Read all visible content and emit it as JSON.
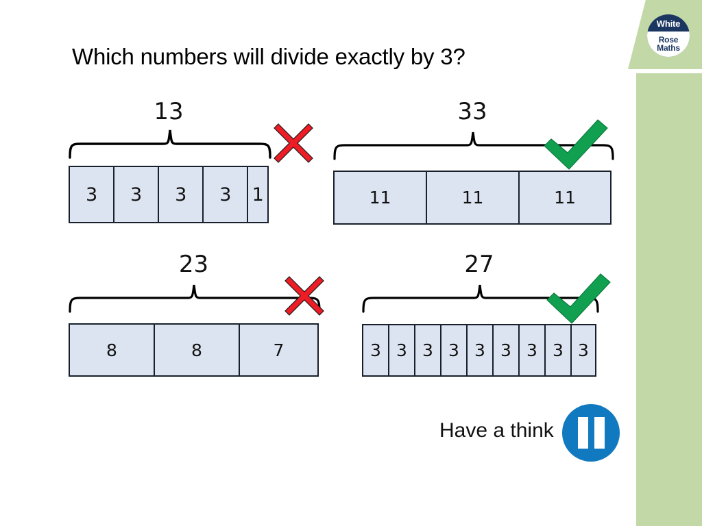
{
  "slide": {
    "title": "Which numbers will divide exactly by 3?",
    "brand": {
      "logo_line1": "White",
      "logo_line2": "Rose",
      "logo_line3": "Maths",
      "panel_color": "#c2d8a6",
      "logo_color": "#1b3661"
    },
    "prompt": {
      "label": "Have a think",
      "icon": "pause-icon",
      "icon_color": "#1179bf"
    },
    "colors": {
      "cell_fill": "#dde4f1",
      "cell_border": "#17202b",
      "cross": "#ee1c25",
      "tick": "#10a04f"
    }
  },
  "models": [
    {
      "id": "model-13",
      "total": "13",
      "parts": [
        "3",
        "3",
        "3",
        "3",
        "1"
      ],
      "part_widths": [
        66,
        66,
        66,
        66,
        32
      ],
      "verdict": "cross",
      "verdict_name": "cross-icon"
    },
    {
      "id": "model-33",
      "total": "33",
      "parts": [
        "11",
        "11",
        "11"
      ],
      "part_widths": [
        135,
        135,
        136
      ],
      "verdict": "tick",
      "verdict_name": "tick-icon"
    },
    {
      "id": "model-23",
      "total": "23",
      "parts": [
        "8",
        "8",
        "7"
      ],
      "part_widths": [
        124,
        124,
        117
      ],
      "verdict": "cross",
      "verdict_name": "cross-icon"
    },
    {
      "id": "model-27",
      "total": "27",
      "parts": [
        "3",
        "3",
        "3",
        "3",
        "3",
        "3",
        "3",
        "3",
        "3"
      ],
      "part_widths": [
        38,
        38,
        38,
        38,
        38,
        38,
        38,
        38,
        38
      ],
      "verdict": "tick",
      "verdict_name": "tick-icon"
    }
  ]
}
